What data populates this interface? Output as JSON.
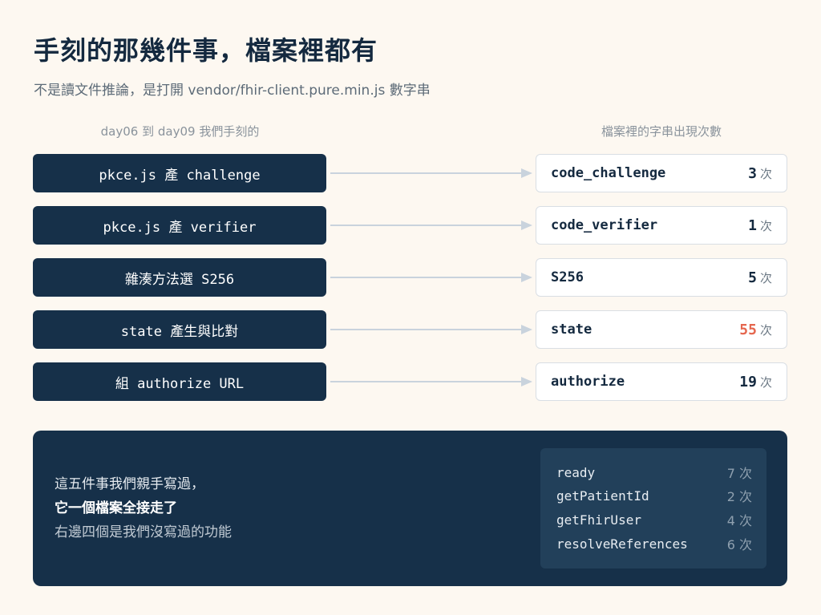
{
  "title": "手刻的那幾件事，檔案裡都有",
  "subtitle": "不是讀文件推論，是打開 vendor/fhir-client.pure.min.js 數字串",
  "headers": {
    "left": "day06 到 day09 我們手刻的",
    "right": "檔案裡的字串出現次數"
  },
  "unit": "次",
  "rows": [
    {
      "left": "pkce.js 產 challenge",
      "name": "code_challenge",
      "count": "3",
      "highlight": false
    },
    {
      "left": "pkce.js 產 verifier",
      "name": "code_verifier",
      "count": "1",
      "highlight": false
    },
    {
      "left": "雜湊方法選 S256",
      "name": "S256",
      "count": "5",
      "highlight": false
    },
    {
      "left": "state 產生與比對",
      "name": "state",
      "count": "55",
      "highlight": true
    },
    {
      "left": "組 authorize URL",
      "name": "authorize",
      "count": "19",
      "highlight": false
    }
  ],
  "panel": {
    "line1": "這五件事我們親手寫過，",
    "line2": "它一個檔案全接走了",
    "line3": "右邊四個是我們沒寫過的功能",
    "extras": [
      {
        "name": "ready",
        "count": "7 次"
      },
      {
        "name": "getPatientId",
        "count": "2 次"
      },
      {
        "name": "getFhirUser",
        "count": "4 次"
      },
      {
        "name": "resolveReferences",
        "count": "6 次"
      }
    ]
  },
  "colors": {
    "navy": "#163049",
    "highlight": "#e5674f",
    "arrow": "#c9d3dd"
  }
}
